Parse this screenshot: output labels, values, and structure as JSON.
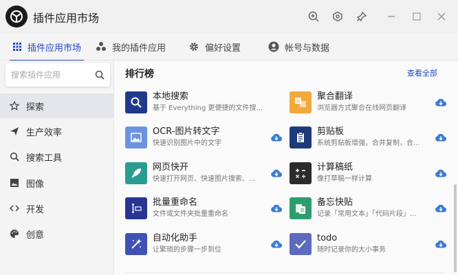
{
  "app": {
    "title": "插件应用市场"
  },
  "tabs": [
    {
      "label": "插件应用市场",
      "icon": "grid-icon"
    },
    {
      "label": "我的插件应用",
      "icon": "dots-icon"
    },
    {
      "label": "偏好设置",
      "icon": "gear-icon"
    },
    {
      "label": "帐号与数据",
      "icon": "user-icon"
    }
  ],
  "search": {
    "placeholder": "搜索插件应用"
  },
  "sidebar": {
    "items": [
      {
        "label": "探索",
        "icon": "star-icon"
      },
      {
        "label": "生产效率",
        "icon": "send-icon"
      },
      {
        "label": "搜索工具",
        "icon": "search-icon"
      },
      {
        "label": "图像",
        "icon": "image-icon"
      },
      {
        "label": "开发",
        "icon": "code-icon"
      },
      {
        "label": "创意",
        "icon": "palette-icon"
      }
    ]
  },
  "main": {
    "section_title": "排行榜",
    "view_all": "查看全部",
    "plugins": [
      {
        "name": "本地搜索",
        "desc": "基于 Everything 更便捷的文件搜索...",
        "icon_color": "#1f3a8a",
        "icon": "search-icon",
        "downloadable": true
      },
      {
        "name": "聚合翻译",
        "desc": "浏览器方式聚合在线网页翻译",
        "icon_color": "#f2a93b",
        "icon": "translate-icon",
        "downloadable": true
      },
      {
        "name": "OCR-图片转文字",
        "desc": "快速识别图片中的文字",
        "icon_color": "#6b93e0",
        "icon": "image-icon",
        "downloadable": true
      },
      {
        "name": "剪贴板",
        "desc": "系统剪贴板增强，合并复制，合...",
        "icon_color": "#1f3a7a",
        "icon": "clipboard-icon",
        "downloadable": true
      },
      {
        "name": "网页快开",
        "desc": "快速打开网页、快速图片搜索、...",
        "icon_color": "#2a9d8f",
        "icon": "rocket-icon",
        "downloadable": true
      },
      {
        "name": "计算稿纸",
        "desc": "像打草稿一样计算",
        "icon_color": "#2b2b2b",
        "icon": "calculator-icon",
        "downloadable": true
      },
      {
        "name": "批量重命名",
        "desc": "文件或文件夹批量重命名",
        "icon_color": "#283593",
        "icon": "rename-icon",
        "downloadable": true
      },
      {
        "name": "备忘快贴",
        "desc": "记录「常用文本」「代码片段」...",
        "icon_color": "#2e9d6e",
        "icon": "paste-icon",
        "downloadable": true
      },
      {
        "name": "自动化助手",
        "desc": "让繁琐的步骤一步到位",
        "icon_color": "#3f51b5",
        "icon": "magic-icon",
        "downloadable": true
      },
      {
        "name": "todo",
        "desc": "随时记录你的大小事务",
        "icon_color": "#5c6bc0",
        "icon": "check-icon",
        "downloadable": true
      }
    ]
  },
  "colors": {
    "accent": "#2447c5",
    "download": "#3a7bd5"
  }
}
